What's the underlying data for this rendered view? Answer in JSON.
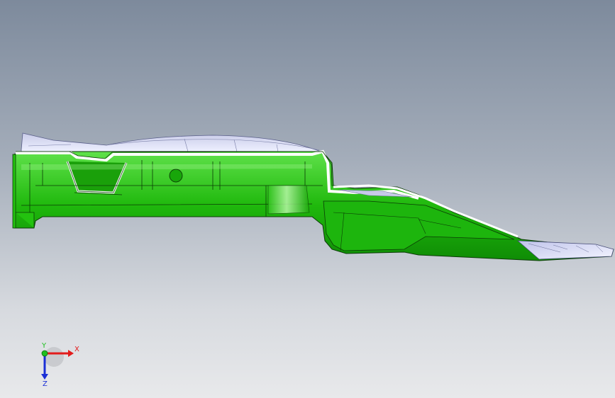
{
  "viewport": {
    "background_top": "#7d8a9c",
    "background_bottom": "#e8e9eb"
  },
  "model": {
    "body_color": "#22c40f",
    "edge_color": "#0b3b06",
    "highlight_color": "#6ef05a",
    "section_color": "#ffffff",
    "top_surface_color": "#d7d9f2"
  },
  "triad": {
    "x_label": "X",
    "y_label": "Y",
    "z_label": "Z",
    "x_color": "#e21b1b",
    "y_color": "#1fbf1f",
    "z_color": "#1b2fd6"
  }
}
